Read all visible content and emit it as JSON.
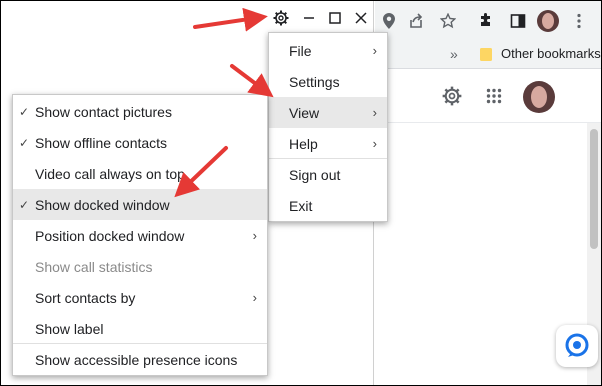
{
  "main_menu": {
    "items": [
      {
        "label": "File",
        "submenu": true
      },
      {
        "label": "Settings",
        "submenu": false
      },
      {
        "label": "View",
        "submenu": true,
        "active": true
      },
      {
        "label": "Help",
        "submenu": true
      },
      {
        "label": "Sign out",
        "submenu": false
      },
      {
        "label": "Exit",
        "submenu": false
      }
    ]
  },
  "view_menu": {
    "items": [
      {
        "label": "Show contact pictures",
        "checked": true
      },
      {
        "label": "Show offline contacts",
        "checked": true
      },
      {
        "label": "Video call always on top",
        "checked": false
      },
      {
        "label": "Show docked window",
        "checked": true,
        "active": true
      },
      {
        "label": "Position docked window",
        "submenu": true
      },
      {
        "label": "Show call statistics",
        "disabled": true
      },
      {
        "label": "Sort contacts by",
        "submenu": true
      },
      {
        "label": "Show label"
      },
      {
        "label": "Show accessible presence icons"
      }
    ]
  },
  "browser": {
    "bookmarks_overflow": "»",
    "other_bookmarks": "Other bookmarks"
  },
  "glyphs": {
    "check": "✓",
    "submenu_arrow": "›"
  },
  "colors": {
    "annotation_red": "#e53935",
    "menu_highlight": "#e8e8e8",
    "disabled_text": "#8a8a8a"
  }
}
